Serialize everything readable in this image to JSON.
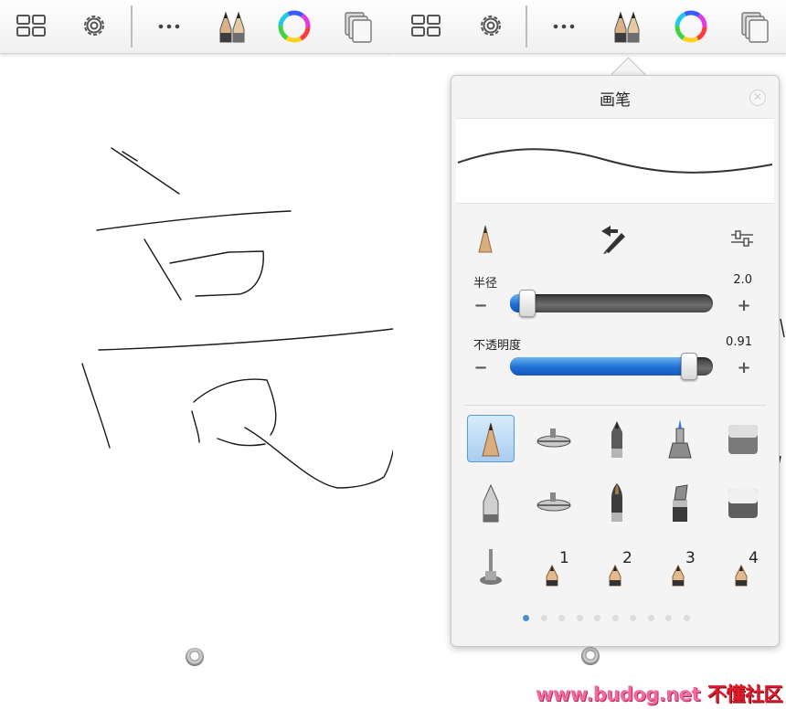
{
  "toolbar": {
    "icons": [
      "grid-icon",
      "gear-icon",
      "more-icon",
      "brushes-icon",
      "color-wheel-icon",
      "layers-icon"
    ]
  },
  "brush_panel": {
    "title": "画笔",
    "close_icon": "close-icon",
    "radius": {
      "label": "半径",
      "value": "2.0",
      "fraction": 0.05,
      "minus": "−",
      "plus": "+"
    },
    "opacity": {
      "label": "不透明度",
      "value": "0.91",
      "fraction": 0.91,
      "minus": "−",
      "plus": "+"
    },
    "brush_numbers": [
      "1",
      "2",
      "3",
      "4"
    ],
    "pages": {
      "count": 10,
      "active": 0
    }
  },
  "colors": {
    "accent_blue": "#1f6fd6",
    "selected_bg": "#a8cdf1",
    "watermark_pink": "#f06a9c",
    "watermark_red": "#e01b2e"
  },
  "watermark": {
    "site": "www.budog.net",
    "name": "不懂社区"
  }
}
